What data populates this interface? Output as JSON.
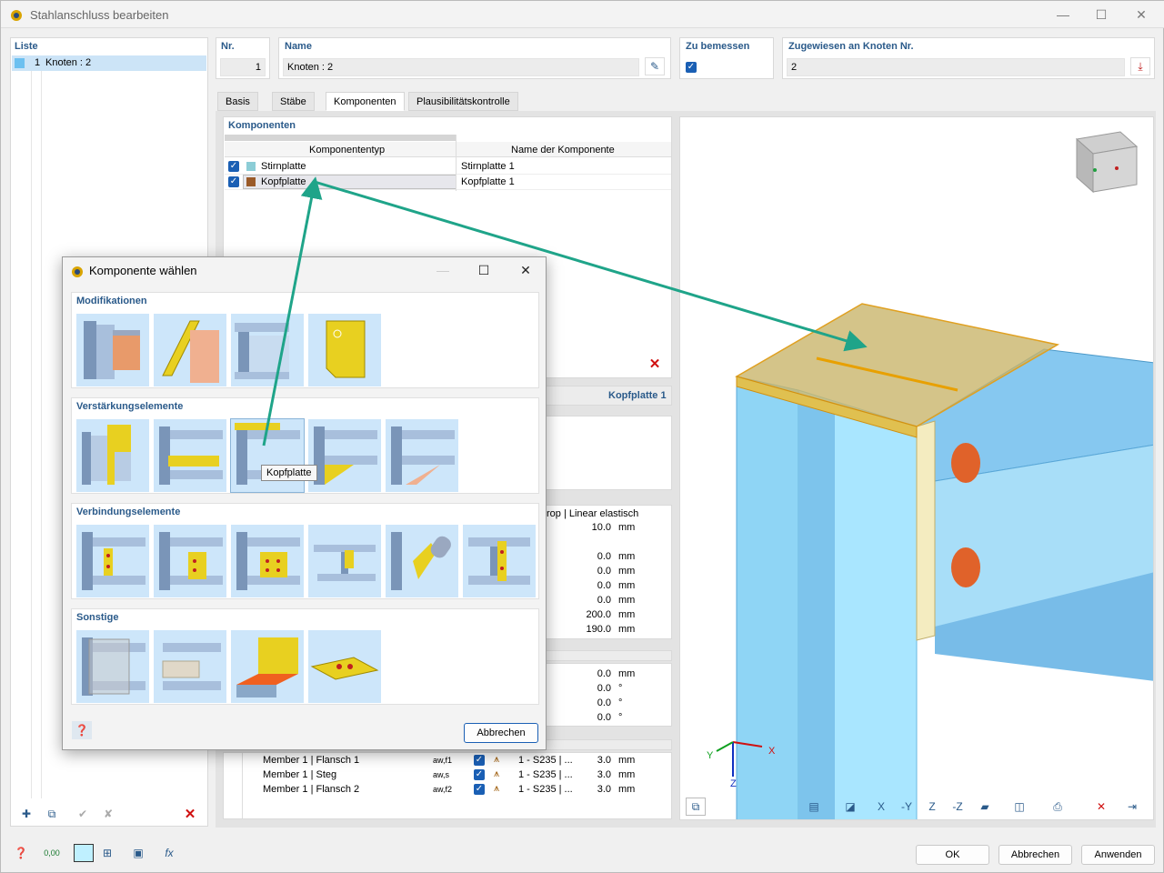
{
  "window": {
    "title": "Stahlanschluss bearbeiten",
    "min": "—",
    "max": "☐",
    "close": "✕"
  },
  "liste": {
    "header": "Liste",
    "item_number": "1",
    "item_label": "Knoten : 2"
  },
  "nr": {
    "label": "Nr.",
    "value": "1"
  },
  "name": {
    "label": "Name",
    "value": "Knoten : 2"
  },
  "zu_bemessen": {
    "label": "Zu bemessen"
  },
  "zugewiesen": {
    "label": "Zugewiesen an Knoten Nr.",
    "value": "2"
  },
  "tabs": [
    "Basis",
    "Stäbe",
    "Komponenten",
    "Plausibilitätskontrolle"
  ],
  "komponenten": {
    "header": "Komponenten",
    "col1": "Komponententyp",
    "col2": "Name der Komponente",
    "rows": [
      {
        "type": "Stirnplatte",
        "name": "Stirnplatte 1",
        "color": "#8ccdd6"
      },
      {
        "type": "Kopfplatte",
        "name": "Kopfplatte 1",
        "color": "#9a5a28"
      }
    ]
  },
  "detail": {
    "title": "Kopfplatte 1",
    "material": "rop | Linear elastisch",
    "values": [
      {
        "v": "10.0",
        "u": "mm"
      },
      {
        "v": "0.0",
        "u": "mm"
      },
      {
        "v": "0.0",
        "u": "mm"
      },
      {
        "v": "0.0",
        "u": "mm"
      },
      {
        "v": "0.0",
        "u": "mm"
      },
      {
        "v": "200.0",
        "u": "mm"
      },
      {
        "v": "190.0",
        "u": "mm"
      }
    ],
    "angles": [
      {
        "v": "0.0",
        "u": "mm"
      },
      {
        "v": "0.0",
        "u": "°"
      },
      {
        "v": "0.0",
        "u": "°"
      },
      {
        "v": "0.0",
        "u": "°"
      }
    ]
  },
  "welds": [
    {
      "member": "Member 1 | Flansch 1",
      "sym": "aw,f1",
      "mat": "1 - S235 | ...",
      "v": "3.0",
      "u": "mm"
    },
    {
      "member": "Member 1 | Steg",
      "sym": "aw,s",
      "mat": "1 - S235 | ...",
      "v": "3.0",
      "u": "mm"
    },
    {
      "member": "Member 1 | Flansch 2",
      "sym": "aw,f2",
      "mat": "1 - S235 | ...",
      "v": "3.0",
      "u": "mm"
    }
  ],
  "dialog": {
    "title": "Komponente wählen",
    "sections": [
      "Modifikationen",
      "Verstärkungselemente",
      "Verbindungselemente",
      "Sonstige"
    ],
    "tooltip": "Kopfplatte",
    "cancel": "Abbrechen"
  },
  "footer": {
    "ok": "OK",
    "cancel": "Abbrechen",
    "apply": "Anwenden"
  },
  "axes": {
    "x": "X",
    "y": "Y",
    "z": "Z"
  },
  "colors": {
    "accent": "#1a5fb4",
    "header_text": "#2a5a8a",
    "arrow": "#1fa489",
    "steel": "#86c8f0",
    "plate": "#c9b56b"
  }
}
